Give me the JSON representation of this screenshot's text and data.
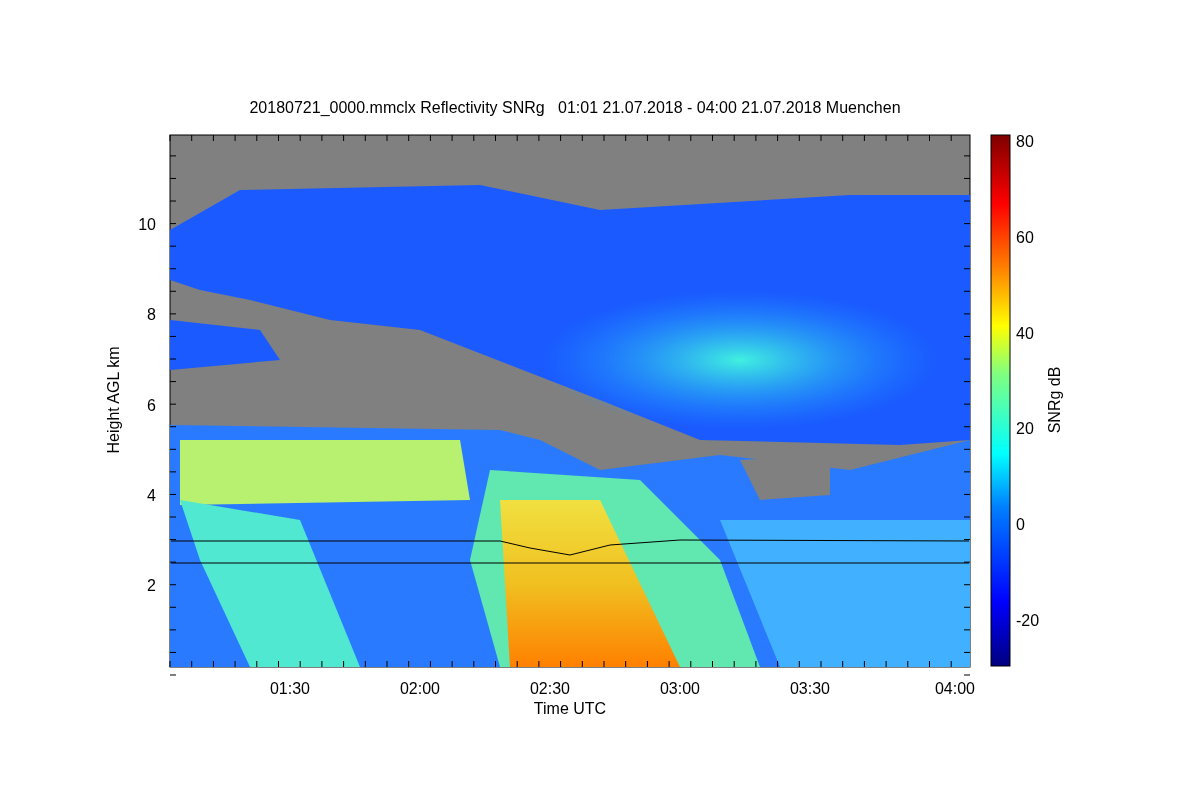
{
  "title": "20180721_0000.mmclx Reflectivity SNRg   01:01 21.07.2018 - 04:00 21.07.2018 Muenchen",
  "y_axis": {
    "label": "Height AGL km",
    "ticks": [
      "10",
      "8",
      "6",
      "4",
      "2"
    ]
  },
  "x_axis": {
    "label": "Time UTC",
    "ticks": [
      "01:30",
      "02:00",
      "02:30",
      "03:00",
      "03:30",
      "04:00"
    ]
  },
  "colorbar": {
    "label": "SNRg dB",
    "ticks": [
      "80",
      "60",
      "40",
      "20",
      "0",
      "-20"
    ]
  }
}
